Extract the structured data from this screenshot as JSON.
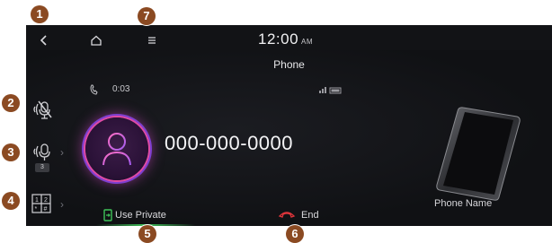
{
  "callouts": [
    "1",
    "2",
    "3",
    "4",
    "5",
    "6",
    "7"
  ],
  "topbar": {
    "back_icon": "chevron-left-icon",
    "home_icon": "home-icon",
    "menu_icon": "hamburger-menu-icon",
    "clock": "12:00",
    "ampm": "AM"
  },
  "screen_title": "Phone",
  "call": {
    "duration": "0:03",
    "number": "000-000-0000"
  },
  "side_buttons": [
    {
      "icon": "microphone-mute-icon"
    },
    {
      "icon": "microphone-volume-icon",
      "value": "3"
    },
    {
      "icon": "keypad-icon"
    }
  ],
  "actions": {
    "use_private": "Use Private",
    "end": "End"
  },
  "device": {
    "phone_name": "Phone Name"
  },
  "colors": {
    "callout": "#8b4a22",
    "accent_green": "#3fc45a",
    "end_red": "#e0353b",
    "avatar_pink": "#e04aa3",
    "avatar_purple": "#7e3fd0"
  }
}
